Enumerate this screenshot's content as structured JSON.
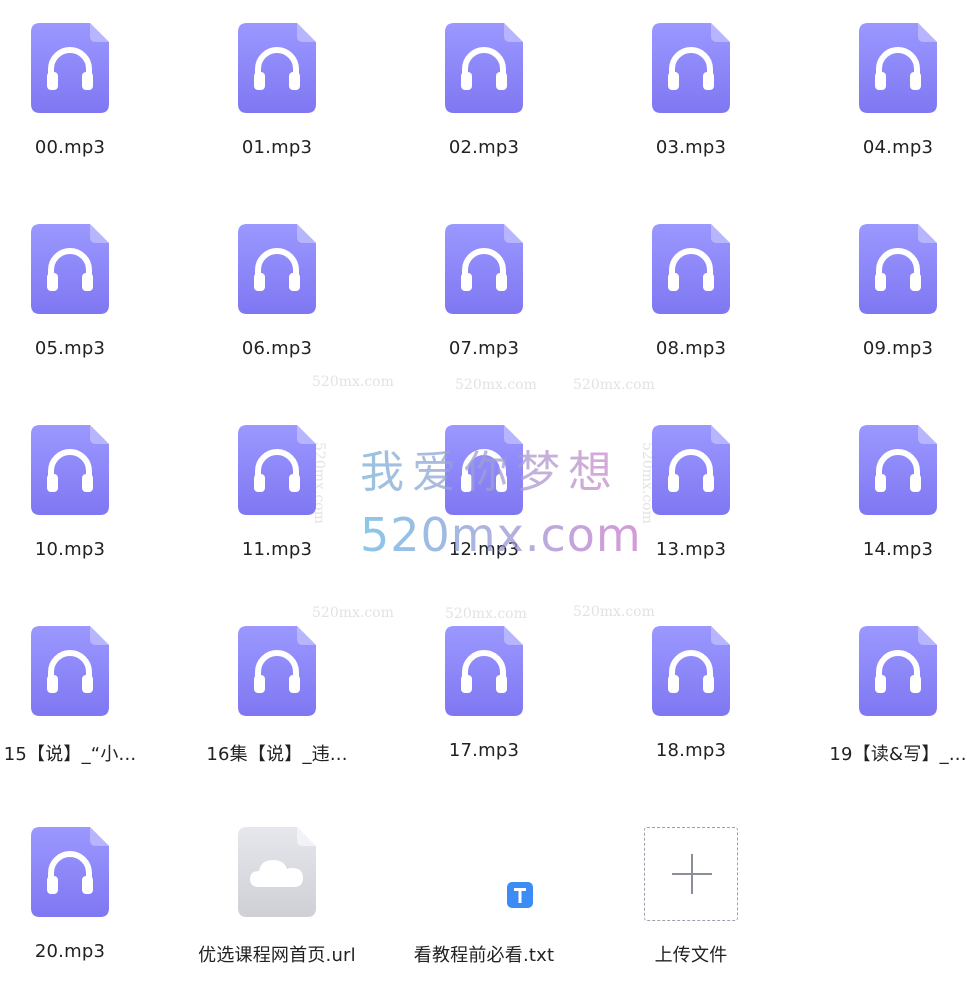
{
  "colors": {
    "audio_icon_top": "#9b98ff",
    "audio_icon_bottom": "#7f77f2",
    "audio_icon_fold": "#c3c0ff",
    "link_icon_top": "#e6e7ec",
    "link_icon_bottom": "#cfd0d6",
    "txt_badge": "#3d8bf5",
    "label_text": "#222222",
    "upload_border": "#9da1ad"
  },
  "files": [
    {
      "name": "00.mp3",
      "icon": "headphones-icon",
      "type": "audio"
    },
    {
      "name": "01.mp3",
      "icon": "headphones-icon",
      "type": "audio"
    },
    {
      "name": "02.mp3",
      "icon": "headphones-icon",
      "type": "audio"
    },
    {
      "name": "03.mp3",
      "icon": "headphones-icon",
      "type": "audio"
    },
    {
      "name": "04.mp3",
      "icon": "headphones-icon",
      "type": "audio"
    },
    {
      "name": "05.mp3",
      "icon": "headphones-icon",
      "type": "audio"
    },
    {
      "name": "06.mp3",
      "icon": "headphones-icon",
      "type": "audio"
    },
    {
      "name": "07.mp3",
      "icon": "headphones-icon",
      "type": "audio"
    },
    {
      "name": "08.mp3",
      "icon": "headphones-icon",
      "type": "audio"
    },
    {
      "name": "09.mp3",
      "icon": "headphones-icon",
      "type": "audio"
    },
    {
      "name": "10.mp3",
      "icon": "headphones-icon",
      "type": "audio"
    },
    {
      "name": "11.mp3",
      "icon": "headphones-icon",
      "type": "audio"
    },
    {
      "name": "12.mp3",
      "icon": "headphones-icon",
      "type": "audio"
    },
    {
      "name": "13.mp3",
      "icon": "headphones-icon",
      "type": "audio"
    },
    {
      "name": "14.mp3",
      "icon": "headphones-icon",
      "type": "audio"
    },
    {
      "name": "15【说】_“小...",
      "icon": "headphones-icon",
      "type": "audio"
    },
    {
      "name": "16集【说】_违...",
      "icon": "headphones-icon",
      "type": "audio"
    },
    {
      "name": "17.mp3",
      "icon": "headphones-icon",
      "type": "audio"
    },
    {
      "name": "18.mp3",
      "icon": "headphones-icon",
      "type": "audio"
    },
    {
      "name": "19【读&写】_...",
      "icon": "headphones-icon",
      "type": "audio"
    },
    {
      "name": "20.mp3",
      "icon": "headphones-icon",
      "type": "audio"
    },
    {
      "name": "优选课程网首页.url",
      "icon": "cloud-icon",
      "type": "link"
    },
    {
      "name": "看教程前必看.txt",
      "icon": "text-file-icon",
      "type": "text"
    }
  ],
  "upload": {
    "label": "上传文件",
    "icon": "plus-icon"
  },
  "watermark": {
    "chinese": "我爱你梦想",
    "domain_large": "520mx.com",
    "domain_small": "520mx.com"
  }
}
